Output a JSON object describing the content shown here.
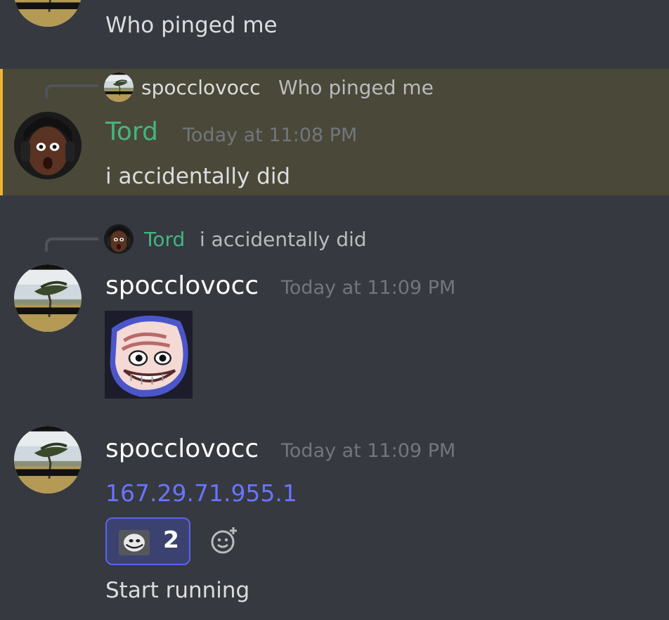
{
  "messages": {
    "top": {
      "text": "Who pinged me"
    },
    "tord": {
      "reply": {
        "author": "spocclovocc",
        "text": "Who pinged me"
      },
      "author": "Tord",
      "timestamp": "Today at 11:08 PM",
      "text": "i accidentally did"
    },
    "spocc_1": {
      "reply": {
        "author": "Tord",
        "text": "i accidentally did"
      },
      "author": "spocclovocc",
      "timestamp": "Today at 11:09 PM"
    },
    "spocc_2": {
      "author": "spocclovocc",
      "timestamp": "Today at 11:09 PM",
      "link": "167.29.71.955.1",
      "reaction": {
        "count": "2"
      },
      "text": "Start running"
    }
  },
  "colors": {
    "background": "#36393f",
    "highlight": "#4a4838",
    "highlight_bar": "#f0b232",
    "tord_name": "#43b581",
    "link": "#6a74ff"
  },
  "icons": {
    "avatar_spocc": "windswept-tree-avatar",
    "avatar_tord": "surprised-face-avatar",
    "emoji": "trollface-emoji",
    "add_reaction": "add-reaction-icon"
  }
}
